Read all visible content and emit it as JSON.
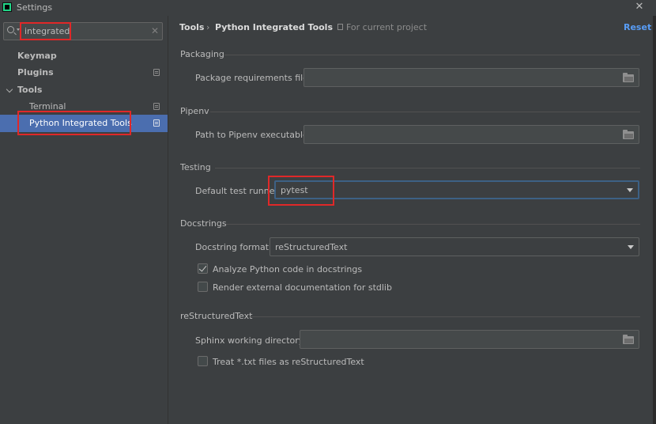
{
  "window": {
    "title": "Settings",
    "close_glyph": "✕"
  },
  "sidebar": {
    "search": {
      "value": "integrated",
      "clear_glyph": "✕"
    },
    "items": [
      {
        "label": "Keymap"
      },
      {
        "label": "Plugins"
      },
      {
        "label": "Tools"
      },
      {
        "label": "Terminal"
      },
      {
        "label": "Python Integrated Tools",
        "selected": true
      }
    ]
  },
  "header": {
    "breadcrumb": [
      "Tools",
      "Python Integrated Tools"
    ],
    "breadcrumb_separator": "›",
    "scope_note": "For current project",
    "reset_label": "Reset"
  },
  "sections": {
    "packaging": {
      "title": "Packaging",
      "requirements_label": "Package requirements file:",
      "requirements_value": ""
    },
    "pipenv": {
      "title": "Pipenv",
      "path_label": "Path to Pipenv executable:",
      "path_value": ""
    },
    "testing": {
      "title": "Testing",
      "runner_label": "Default test runner:",
      "runner_value": "pytest"
    },
    "docstrings": {
      "title": "Docstrings",
      "format_label": "Docstring format:",
      "format_value": "reStructuredText",
      "analyze_label": "Analyze Python code in docstrings",
      "analyze_checked": true,
      "render_label": "Render external documentation for stdlib",
      "render_checked": false
    },
    "restructuredtext": {
      "title": "reStructuredText",
      "sphinx_label": "Sphinx working directory:",
      "sphinx_value": "",
      "treat_label": "Treat *.txt files as reStructuredText",
      "treat_checked": false
    }
  },
  "colors": {
    "accent": "#4b6eaf",
    "link": "#589df6",
    "highlight_box": "#e02828",
    "focus_ring": "#3d6185"
  }
}
